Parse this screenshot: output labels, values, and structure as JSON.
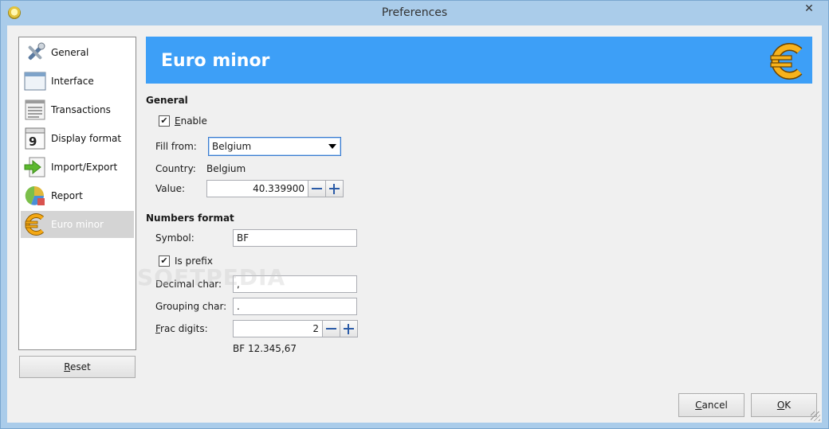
{
  "window": {
    "title": "Preferences",
    "close_glyph": "✕"
  },
  "sidebar": {
    "items": [
      {
        "label": "General",
        "icon": "tools-icon"
      },
      {
        "label": "Interface",
        "icon": "window-icon"
      },
      {
        "label": "Transactions",
        "icon": "list-icon"
      },
      {
        "label": "Display format",
        "icon": "calendar-icon"
      },
      {
        "label": "Import/Export",
        "icon": "import-arrow-icon"
      },
      {
        "label": "Report",
        "icon": "pie-chart-icon"
      },
      {
        "label": "Euro minor",
        "icon": "euro-icon",
        "selected": true
      }
    ],
    "reset_prefix": "",
    "reset_mnemonic": "R",
    "reset_rest": "eset"
  },
  "banner": {
    "title": "Euro minor",
    "icon": "euro-icon",
    "color": "#3d9ff7"
  },
  "general": {
    "heading": "General",
    "enable_mnemonic": "E",
    "enable_rest": "nable",
    "enable_checked": true,
    "fill_from_label": "Fill from:",
    "fill_from_value": "Belgium",
    "country_label": "Country:",
    "country_value": "Belgium",
    "value_label": "Value:",
    "value_value": "40.339900"
  },
  "numbers": {
    "heading": "Numbers format",
    "symbol_label": "Symbol:",
    "symbol_value": "BF",
    "is_prefix_label": "Is prefix",
    "is_prefix_checked": true,
    "decimal_label": "Decimal char:",
    "decimal_value": ",",
    "grouping_label": "Grouping char:",
    "grouping_value": ".",
    "frac_mnemonic": "F",
    "frac_rest": "rac digits:",
    "frac_value": "2",
    "preview": "BF 12.345,67"
  },
  "buttons": {
    "cancel_mnemonic": "C",
    "cancel_rest": "ancel",
    "ok_mnemonic": "O",
    "ok_rest": "K"
  },
  "watermark": "SOFTPEDIA"
}
